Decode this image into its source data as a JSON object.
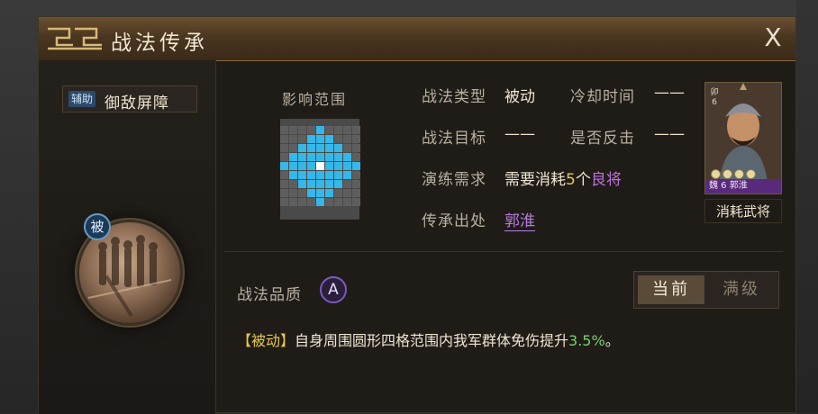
{
  "window": {
    "title": "战法传承",
    "close_label": "X"
  },
  "skill": {
    "type_tag": "辅助",
    "name": "御敌屏障",
    "emblem_badge": "被"
  },
  "range": {
    "title": "影响范围",
    "grid_size": 9,
    "color_active": "#35b8e8",
    "color_center": "#ffffff",
    "color_empty": "#5e5e5e"
  },
  "info": {
    "type_label": "战法类型",
    "type_value": "被动",
    "cooldown_label": "冷却时间",
    "cooldown_value": "——",
    "target_label": "战法目标",
    "target_value": "——",
    "counter_label": "是否反击",
    "counter_value": "——",
    "requirement_label": "演练需求",
    "requirement_prefix": "需要消耗",
    "requirement_count": "5",
    "requirement_unit": "个",
    "requirement_grade": "良将",
    "source_label": "传承出处",
    "source_value": "郭淮"
  },
  "general": {
    "rank_text": "卯6",
    "caption": "魏 6 郭淮",
    "consume_label": "消耗武将",
    "star_count": 4
  },
  "quality": {
    "label": "战法品质",
    "grade": "A"
  },
  "level_toggle": {
    "current": "当前",
    "max": "满级"
  },
  "description": {
    "tag": "【被动】",
    "text": "自身周围圆形四格范围内我军群体免伤提升",
    "value": "3.5%",
    "end": "。"
  },
  "colors": {
    "accent_gold": "#e8c84a",
    "accent_purple": "#c070e0",
    "accent_green": "#7ad06a"
  }
}
